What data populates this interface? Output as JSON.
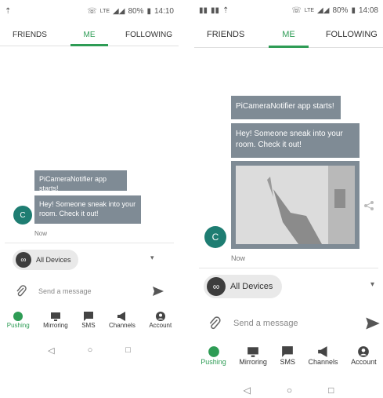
{
  "left": {
    "status": {
      "time": "14:10",
      "battery": "80%",
      "network": "LTE"
    },
    "tabs": [
      {
        "label": "FRIENDS"
      },
      {
        "label": "ME"
      },
      {
        "label": "FOLLOWING"
      }
    ],
    "messages": [
      {
        "text": "PiCameraNotifier app starts!"
      },
      {
        "text": "Hey! Someone sneak into your room. Check it out!"
      }
    ],
    "avatar_letter": "C",
    "time": "Now",
    "device": "All Devices",
    "composer": {
      "placeholder": "Send a message"
    },
    "nav": [
      {
        "label": "Pushing"
      },
      {
        "label": "Mirroring"
      },
      {
        "label": "SMS"
      },
      {
        "label": "Channels"
      },
      {
        "label": "Account"
      }
    ]
  },
  "right": {
    "status": {
      "time": "14:08",
      "battery": "80%",
      "network": "LTE"
    },
    "tabs": [
      {
        "label": "FRIENDS"
      },
      {
        "label": "ME"
      },
      {
        "label": "FOLLOWING"
      }
    ],
    "messages": [
      {
        "text": "PiCameraNotifier app starts!"
      },
      {
        "text": "Hey! Someone sneak into your room. Check it out!"
      }
    ],
    "avatar_letter": "C",
    "time": "Now",
    "device": "All Devices",
    "composer": {
      "placeholder": "Send a message"
    },
    "nav": [
      {
        "label": "Pushing"
      },
      {
        "label": "Mirroring"
      },
      {
        "label": "SMS"
      },
      {
        "label": "Channels"
      },
      {
        "label": "Account"
      }
    ]
  },
  "colors": {
    "accent": "#2e9c55",
    "bubble": "#7f8b95",
    "avatar": "#1e7d72"
  },
  "icons": [
    "alarm-icon",
    "lte-icon",
    "signal-icon",
    "battery-icon",
    "paperclip-icon",
    "send-icon",
    "pushing-icon",
    "mirroring-icon",
    "sms-icon",
    "channels-icon",
    "account-icon",
    "share-icon",
    "back-icon",
    "home-icon",
    "recents-icon"
  ]
}
